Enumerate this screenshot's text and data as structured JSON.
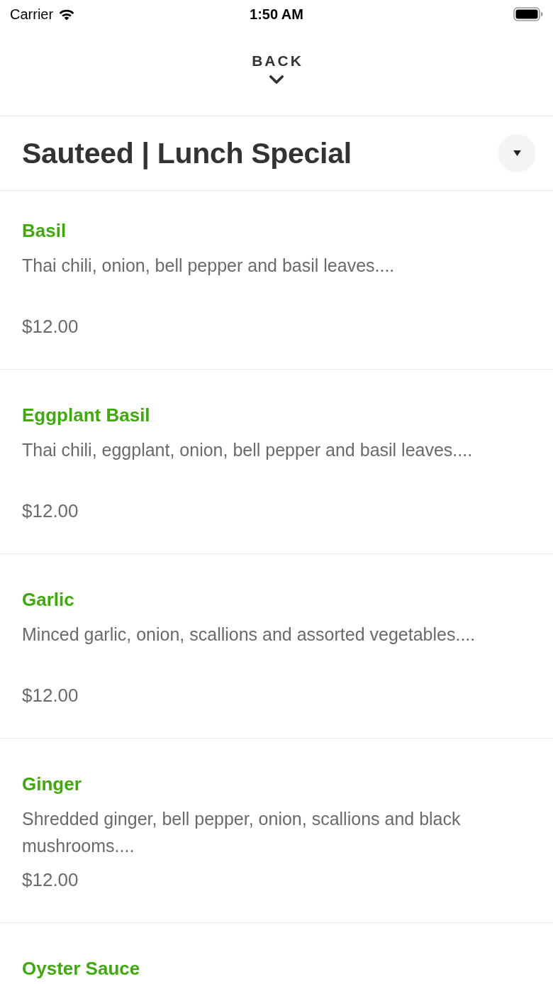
{
  "status_bar": {
    "carrier": "Carrier",
    "time": "1:50 AM"
  },
  "header": {
    "back_label": "BACK"
  },
  "category": {
    "title": "Sauteed | Lunch Special"
  },
  "items": [
    {
      "name": "Basil",
      "description": "Thai chili, onion, bell pepper and basil leaves....",
      "price": "$12.00"
    },
    {
      "name": "Eggplant Basil",
      "description": "Thai chili, eggplant, onion, bell pepper and basil leaves....",
      "price": "$12.00"
    },
    {
      "name": "Garlic",
      "description": "Minced garlic, onion, scallions and assorted vegetables....",
      "price": "$12.00"
    },
    {
      "name": "Ginger",
      "description": "Shredded ginger, bell pepper, onion, scallions and black mushrooms....",
      "price": "$12.00"
    },
    {
      "name": "Oyster Sauce"
    }
  ]
}
